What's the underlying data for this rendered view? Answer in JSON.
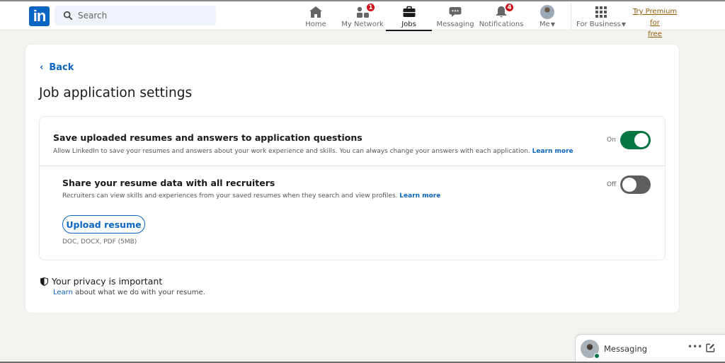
{
  "nav": {
    "search_placeholder": "Search",
    "items": [
      {
        "id": "home",
        "label": "Home",
        "icon": "home-icon",
        "badge": null
      },
      {
        "id": "network",
        "label": "My Network",
        "icon": "people-icon",
        "badge": "1"
      },
      {
        "id": "jobs",
        "label": "Jobs",
        "icon": "briefcase-icon",
        "badge": null,
        "active": true
      },
      {
        "id": "messaging",
        "label": "Messaging",
        "icon": "chat-icon",
        "badge": null
      },
      {
        "id": "notifications",
        "label": "Notifications",
        "icon": "bell-icon",
        "badge": "4"
      },
      {
        "id": "me",
        "label": "Me",
        "icon": "avatar",
        "badge": null
      }
    ],
    "for_business": "For Business",
    "premium_line1": "Try Premium for",
    "premium_line2": "free"
  },
  "page": {
    "back_label": "Back",
    "title": "Job application settings",
    "settings": [
      {
        "title": "Save uploaded resumes and answers to application questions",
        "description": "Allow LinkedIn to save your resumes and answers about your work experience and skills. You can always change your answers with each application.",
        "link": "Learn more",
        "state_label": "On",
        "enabled": true
      },
      {
        "title": "Share your resume data with all recruiters",
        "description": "Recruiters can view skills and experiences from your saved resumes when they search and view profiles.",
        "link": "Learn more",
        "state_label": "Off",
        "enabled": false
      }
    ],
    "upload_button": "Upload resume",
    "formats": "DOC, DOCX, PDF (5MB)",
    "privacy": {
      "heading": "Your privacy is important",
      "link": "Learn",
      "text": " about what we do with your resume."
    }
  },
  "messaging": {
    "label": "Messaging",
    "more": "•••"
  },
  "colors": {
    "brand": "#0a66c2",
    "toggle_on": "#057642",
    "toggle_off": "#5e5e5e",
    "badge": "#cc1016",
    "premium": "#915907",
    "background": "#f3f2ef"
  }
}
